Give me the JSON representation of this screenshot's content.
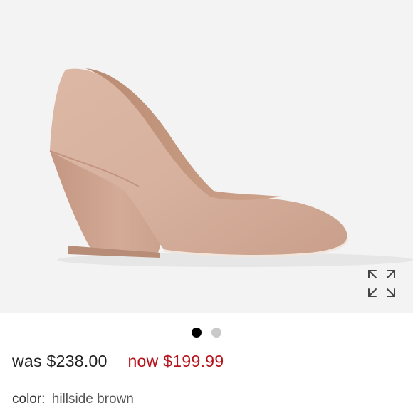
{
  "gallery": {
    "image_icon": "shoe-product-image",
    "expand_icon": "expand-arrows-icon",
    "pager": {
      "count": 2,
      "active_index": 0,
      "active_color": "#000000",
      "inactive_color": "#c9c9c9"
    }
  },
  "pricing": {
    "was_label": "was $238.00",
    "now_label": "now $199.99",
    "now_color": "#b5121b"
  },
  "product": {
    "color_label": "color:",
    "color_value": "hillside brown"
  }
}
